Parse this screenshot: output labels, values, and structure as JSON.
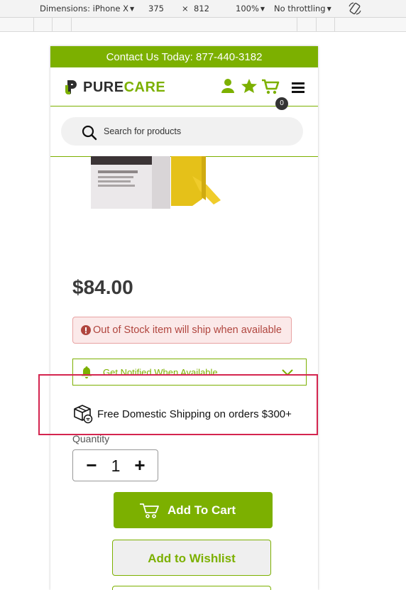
{
  "devtools": {
    "dimensions_label": "Dimensions: iPhone X",
    "width": "375",
    "times": "×",
    "height": "812",
    "zoom": "100%",
    "throttling": "No throttling",
    "rotate_icon": "rotate-icon"
  },
  "page": {
    "topbar_text": "Contact Us Today: 877-440-3182",
    "brand": {
      "pure": "PURE",
      "care": "CARE"
    },
    "header_icons": [
      "user-icon",
      "star-icon",
      "cart-icon",
      "menu-icon"
    ],
    "cart_count": "0",
    "search": {
      "placeholder": "Search for products"
    },
    "price": "$84.00",
    "stock_notice": "Out of Stock item will ship when available",
    "notify_label": "Get Notified When Available",
    "shipping_text": "Free Domestic Shipping on orders $300+",
    "quantity_label": "Quantity",
    "quantity_value": "1",
    "minus_label": "−",
    "plus_label": "+",
    "add_to_cart": "Add To Cart",
    "add_to_wishlist": "Add to Wishlist"
  },
  "colors": {
    "brand_green": "#7cb000",
    "text_dark": "#3a3a3a",
    "alert_red": "#b0453e",
    "highlight": "#d4254f"
  }
}
